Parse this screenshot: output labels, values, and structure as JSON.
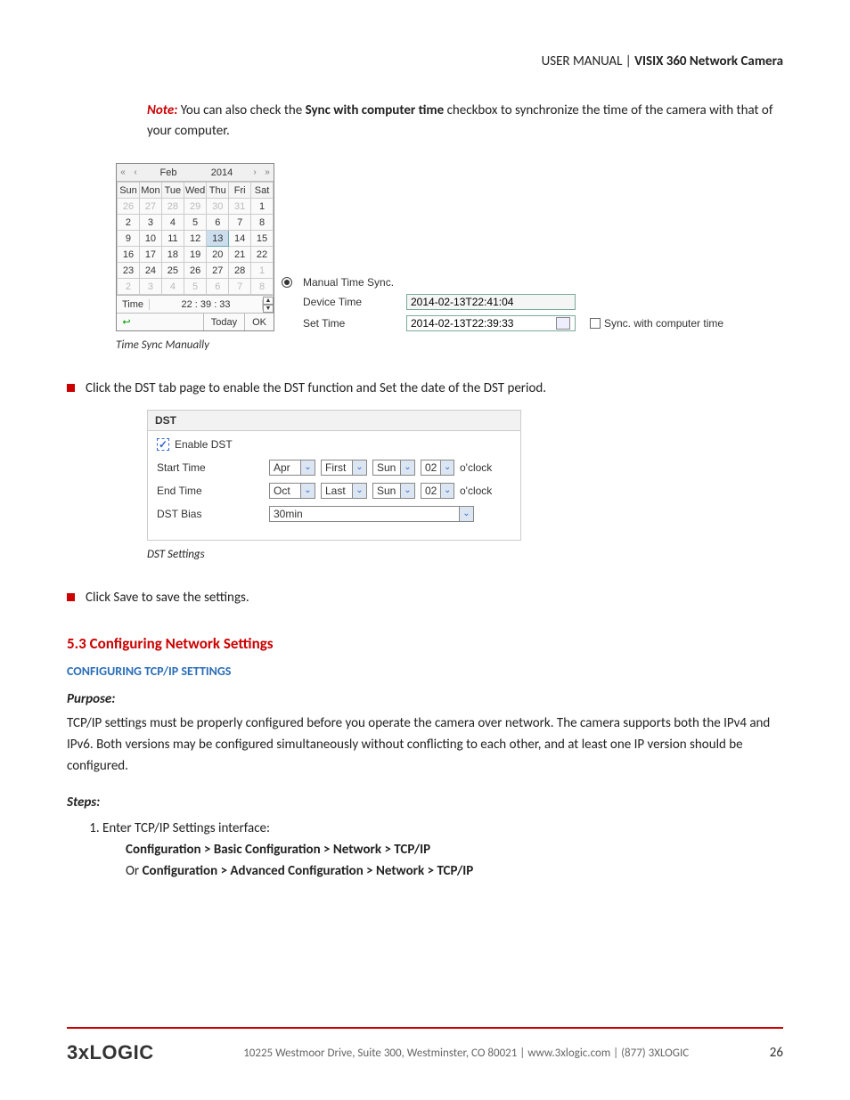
{
  "header": {
    "prefix": "USER MANUAL | ",
    "title": "VISIX 360 Network Camera"
  },
  "note": {
    "label": "Note:",
    "t1": " You can also check the ",
    "bold": "Sync with computer time",
    "t2": " checkbox to synchronize the time of the camera with that of your computer."
  },
  "calendar": {
    "month": "Feb",
    "year": "2014",
    "days": [
      "Sun",
      "Mon",
      "Tue",
      "Wed",
      "Thu",
      "Fri",
      "Sat"
    ],
    "rows": [
      [
        {
          "v": "26",
          "d": 1
        },
        {
          "v": "27",
          "d": 1
        },
        {
          "v": "28",
          "d": 1
        },
        {
          "v": "29",
          "d": 1
        },
        {
          "v": "30",
          "d": 1
        },
        {
          "v": "31",
          "d": 1
        },
        {
          "v": "1"
        }
      ],
      [
        {
          "v": "2"
        },
        {
          "v": "3"
        },
        {
          "v": "4"
        },
        {
          "v": "5"
        },
        {
          "v": "6"
        },
        {
          "v": "7"
        },
        {
          "v": "8"
        }
      ],
      [
        {
          "v": "9"
        },
        {
          "v": "10"
        },
        {
          "v": "11"
        },
        {
          "v": "12"
        },
        {
          "v": "13",
          "s": 1
        },
        {
          "v": "14"
        },
        {
          "v": "15"
        }
      ],
      [
        {
          "v": "16"
        },
        {
          "v": "17"
        },
        {
          "v": "18"
        },
        {
          "v": "19"
        },
        {
          "v": "20"
        },
        {
          "v": "21"
        },
        {
          "v": "22"
        }
      ],
      [
        {
          "v": "23"
        },
        {
          "v": "24"
        },
        {
          "v": "25"
        },
        {
          "v": "26"
        },
        {
          "v": "27"
        },
        {
          "v": "28"
        },
        {
          "v": "1",
          "d": 1
        }
      ],
      [
        {
          "v": "2",
          "d": 1
        },
        {
          "v": "3",
          "d": 1
        },
        {
          "v": "4",
          "d": 1
        },
        {
          "v": "5",
          "d": 1
        },
        {
          "v": "6",
          "d": 1
        },
        {
          "v": "7",
          "d": 1
        },
        {
          "v": "8",
          "d": 1
        }
      ]
    ],
    "time_label": "Time",
    "time_value": "22 : 39 : 33",
    "today": "Today",
    "ok": "OK"
  },
  "timefields": {
    "manual_label": "Manual Time Sync.",
    "device_label": "Device Time",
    "device_value": "2014-02-13T22:41:04",
    "set_label": "Set Time",
    "set_value": "2014-02-13T22:39:33",
    "sync_label": "Sync. with computer time"
  },
  "caption1": "Time Sync Manually",
  "bullet1": "Click the DST tab page to enable the DST function and Set the date of the DST period.",
  "dst": {
    "head": "DST",
    "enable": "Enable DST",
    "start_label": "Start Time",
    "end_label": "End Time",
    "bias_label": "DST Bias",
    "start": {
      "month": "Apr",
      "week": "First",
      "day": "Sun",
      "hour": "02"
    },
    "end": {
      "month": "Oct",
      "week": "Last",
      "day": "Sun",
      "hour": "02"
    },
    "oclock": "o'clock",
    "bias": "30min"
  },
  "caption2": "DST Settings",
  "bullet2": "Click Save to save the settings.",
  "section": {
    "num": "5.3",
    "title": "Configuring Network Settings",
    "sub": "CONFIGURING TCP/IP SETTINGS",
    "purpose_label": "Purpose:",
    "purpose": "TCP/IP settings must be properly configured before you operate the camera over network. The camera supports both the IPv4 and IPv6. Both versions may be configured simultaneously without conflicting to each other, and at least one IP version should be configured.",
    "steps_label": "Steps:",
    "step1": "Enter TCP/IP Settings interface:",
    "path1": "Configuration > Basic Configuration > Network > TCP/IP",
    "or": "Or ",
    "path2": "Configuration > Advanced Configuration > Network > TCP/IP"
  },
  "footer": {
    "logo": "3xLOGIC",
    "addr": "10225 Westmoor Drive, Suite 300, Westminster, CO 80021 | www.3xlogic.com | (877) 3XLOGIC",
    "page": "26"
  }
}
